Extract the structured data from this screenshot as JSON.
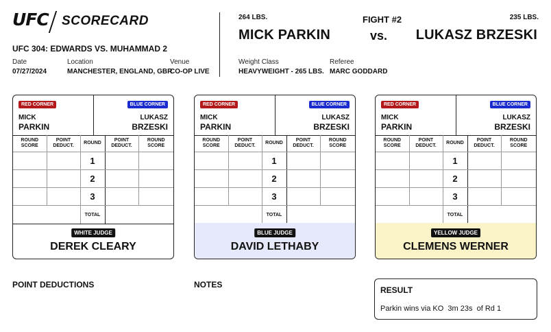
{
  "brand": {
    "logo": "UFC",
    "title": "SCORECARD"
  },
  "event": "UFC 304: EDWARDS VS. MUHAMMAD 2",
  "info": {
    "date_label": "Date",
    "date": "07/27/2024",
    "location_label": "Location",
    "location": "MANCHESTER, ENGLAND, GBR",
    "venue_label": "Venue",
    "venue": "CO-OP LIVE",
    "weight_class_label": "Weight Class",
    "weight_class": "HEAVYWEIGHT - 265 LBS.",
    "referee_label": "Referee",
    "referee": "MARC GODDARD"
  },
  "fight": {
    "number": "FIGHT #2",
    "vs": "vs.",
    "red": {
      "weight": "264 LBS.",
      "name": "MICK PARKIN",
      "first": "MICK",
      "last": "PARKIN"
    },
    "blue": {
      "weight": "235 LBS.",
      "name": "LUKASZ BRZESKI",
      "first": "LUKASZ",
      "last": "BRZESKI"
    }
  },
  "card_labels": {
    "red_corner": "RED CORNER",
    "blue_corner": "BLUE CORNER",
    "round_score_1": "ROUND",
    "round_score_2": "SCORE",
    "point_deduct_1": "POINT",
    "point_deduct_2": "DEDUCT.",
    "round": "ROUND",
    "rounds": [
      "1",
      "2",
      "3"
    ],
    "total": "TOTAL"
  },
  "judges": [
    {
      "tag": "WHITE JUDGE",
      "name": "DEREK CLEARY",
      "color": "#ffffff"
    },
    {
      "tag": "BLUE JUDGE",
      "name": "DAVID LETHABY",
      "color": "#e5e9fb"
    },
    {
      "tag": "YELLOW JUDGE",
      "name": "CLEMENS WERNER",
      "color": "#faf3c8"
    }
  ],
  "sections": {
    "point_deductions": "POINT DEDUCTIONS",
    "notes": "NOTES"
  },
  "result": {
    "heading": "RESULT",
    "text": "Parkin wins via KO  3m 23s  of Rd 1"
  },
  "colors": {
    "red_corner": "#b3181b",
    "blue_corner": "#1a2ccf"
  }
}
